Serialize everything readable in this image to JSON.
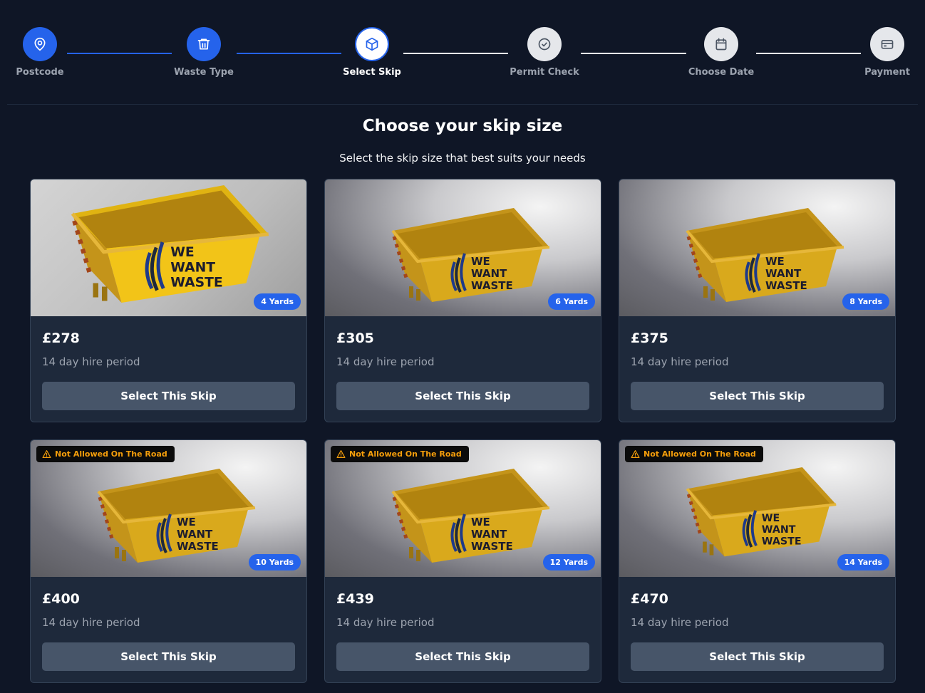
{
  "stepper": {
    "steps": [
      {
        "label": "Postcode",
        "icon": "map-pin-icon",
        "state": "done"
      },
      {
        "label": "Waste Type",
        "icon": "trash-icon",
        "state": "done"
      },
      {
        "label": "Select Skip",
        "icon": "box-icon",
        "state": "current"
      },
      {
        "label": "Permit Check",
        "icon": "check-circle-icon",
        "state": "todo"
      },
      {
        "label": "Choose Date",
        "icon": "calendar-icon",
        "state": "todo"
      },
      {
        "label": "Payment",
        "icon": "credit-card-icon",
        "state": "todo"
      }
    ]
  },
  "header": {
    "title": "Choose your skip size",
    "subtitle": "Select the skip size that best suits your needs"
  },
  "skips": [
    {
      "size_label": "4 Yards",
      "price": "£278",
      "period": "14 day hire period",
      "button": "Select This Skip",
      "warning": ""
    },
    {
      "size_label": "6 Yards",
      "price": "£305",
      "period": "14 day hire period",
      "button": "Select This Skip",
      "warning": ""
    },
    {
      "size_label": "8 Yards",
      "price": "£375",
      "period": "14 day hire period",
      "button": "Select This Skip",
      "warning": ""
    },
    {
      "size_label": "10 Yards",
      "price": "£400",
      "period": "14 day hire period",
      "button": "Select This Skip",
      "warning": "Not Allowed On The Road"
    },
    {
      "size_label": "12 Yards",
      "price": "£439",
      "period": "14 day hire period",
      "button": "Select This Skip",
      "warning": "Not Allowed On The Road"
    },
    {
      "size_label": "14 Yards",
      "price": "£470",
      "period": "14 day hire period",
      "button": "Select This Skip",
      "warning": "Not Allowed On The Road"
    }
  ],
  "skip_logo": {
    "line1": "WE",
    "line2": "WANT",
    "line3": "WASTE"
  },
  "colors": {
    "background": "#0f1626",
    "card": "#1e293b",
    "accent": "#2563eb",
    "button": "#475569",
    "warning": "#f59e0b",
    "skip": "#d9a91c"
  }
}
